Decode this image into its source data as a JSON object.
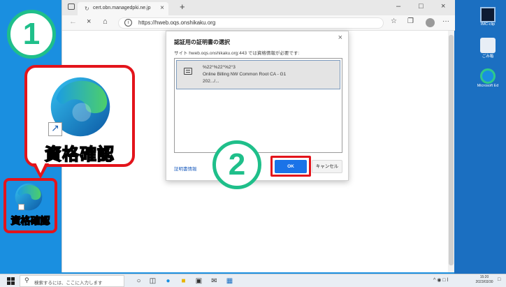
{
  "browser": {
    "tab_title": "cert.obn.managedpki.ne.jp",
    "url": "https://hweb.oqs.onshikaku.org"
  },
  "dialog": {
    "title": "認証用の証明書の選択",
    "subtitle": "サイト hweb.oqs.onshikaku.org:443 では資格情報が必要です:",
    "certificate": {
      "line1": "%22°%22°%2°3",
      "line2": "Online Billing NW Common Root CA - G1",
      "line3": "202.../..."
    },
    "link": "証明書情報",
    "ok_label": "OK",
    "cancel_label": "キャンセル"
  },
  "annotations": {
    "step1": "1",
    "step2": "2",
    "callout_label": "資格確認",
    "desktop_icon_label": "資格確認",
    "accent_color": "#e3141b",
    "badge_color": "#1fbf8a"
  },
  "desktop": {
    "icons": [
      {
        "label": "IMC-clip"
      },
      {
        "label": "ごみ箱"
      },
      {
        "label": "Microsoft Ed"
      }
    ]
  },
  "taskbar": {
    "search_placeholder": "検索するには、ここに入力します",
    "time": "15:20",
    "date": "2023/03/30"
  }
}
